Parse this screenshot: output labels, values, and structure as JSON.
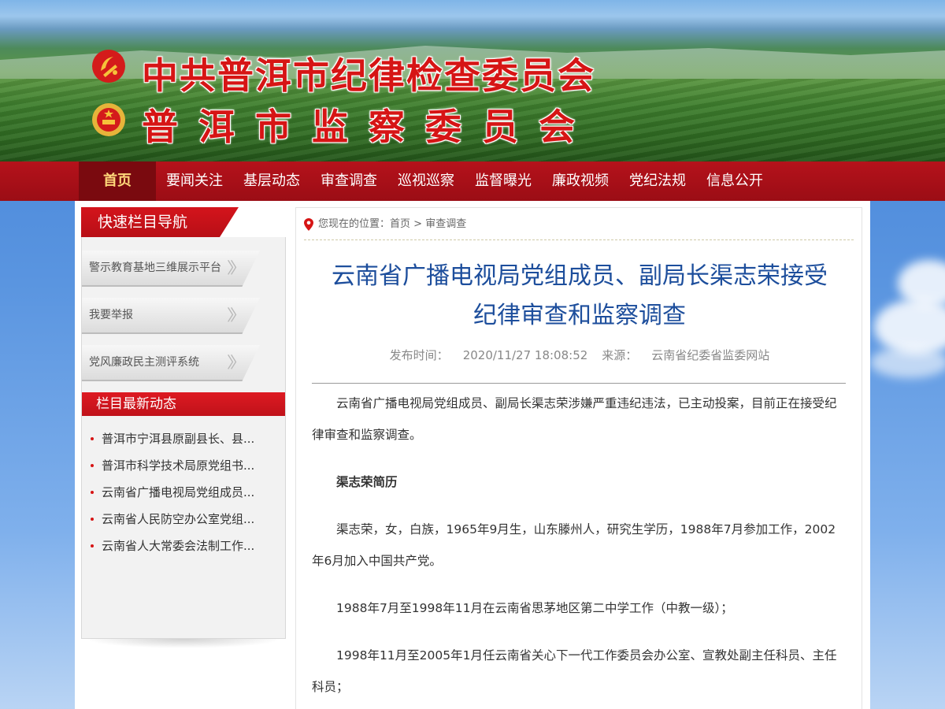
{
  "header": {
    "title_line1": "中共普洱市纪律检查委员会",
    "title_line2": "普洱市监察委员会"
  },
  "nav": {
    "items": [
      "首页",
      "要闻关注",
      "基层动态",
      "审查调查",
      "巡视巡察",
      "监督曝光",
      "廉政视频",
      "党纪法规",
      "信息公开"
    ],
    "active_index": 0
  },
  "sidebar": {
    "quicknav_title": "快速栏目导航",
    "quick_buttons": [
      "警示教育基地三维展示平台",
      "我要举报",
      "党风廉政民主测评系统"
    ],
    "news_title": "栏目最新动态",
    "news_items": [
      "普洱市宁洱县原副县长、县...",
      "普洱市科学技术局原党组书...",
      "云南省广播电视局党组成员...",
      "云南省人民防空办公室党组...",
      "云南省人大常委会法制工作..."
    ]
  },
  "breadcrumb": {
    "prefix": "您现在的位置：",
    "home": "首页",
    "separator": ">",
    "current": "审查调查"
  },
  "article": {
    "title_line1": "云南省广播电视局党组成员、副局长渠志荣接受",
    "title_line2": "纪律审查和监察调查",
    "publish_label": "发布时间：",
    "publish_time": "2020/11/27 18:08:52",
    "source_label": "来源：",
    "source": "云南省纪委省监委网站",
    "paragraphs": [
      "云南省广播电视局党组成员、副局长渠志荣涉嫌严重违纪违法，已主动投案，目前正在接受纪律审查和监察调查。",
      "渠志荣简历",
      "渠志荣，女，白族，1965年9月生，山东滕州人，研究生学历，1988年7月参加工作，2002年6月加入中国共产党。",
      "1988年7月至1998年11月在云南省思茅地区第二中学工作（中教一级）；",
      "1998年11月至2005年1月任云南省关心下一代工作委员会办公室、宣教处副主任科员、主任科员；"
    ]
  },
  "colors": {
    "nav_red": "#b5121b",
    "title_blue": "#1d4e9c",
    "banner_red": "#d61515"
  }
}
